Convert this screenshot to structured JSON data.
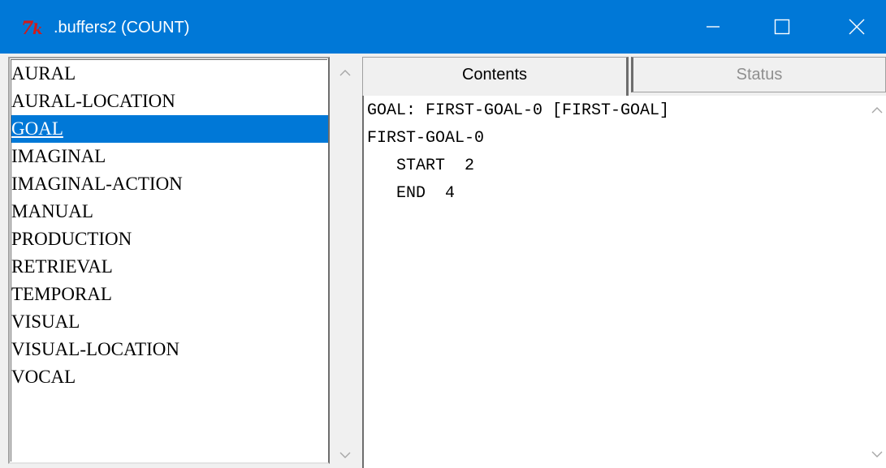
{
  "window": {
    "title": ".buffers2 (COUNT)",
    "logo": "Tk",
    "controls": {
      "minimize_icon": "minimize-icon",
      "maximize_icon": "maximize-icon",
      "close_icon": "close-icon"
    },
    "accent_color": "#0078d7"
  },
  "buffer_list": {
    "items": [
      {
        "label": "AURAL",
        "selected": false
      },
      {
        "label": "AURAL-LOCATION",
        "selected": false
      },
      {
        "label": "GOAL",
        "selected": true
      },
      {
        "label": "IMAGINAL",
        "selected": false
      },
      {
        "label": "IMAGINAL-ACTION",
        "selected": false
      },
      {
        "label": "MANUAL",
        "selected": false
      },
      {
        "label": "PRODUCTION",
        "selected": false
      },
      {
        "label": "RETRIEVAL",
        "selected": false
      },
      {
        "label": "TEMPORAL",
        "selected": false
      },
      {
        "label": "VISUAL",
        "selected": false
      },
      {
        "label": "VISUAL-LOCATION",
        "selected": false
      },
      {
        "label": "VOCAL",
        "selected": false
      }
    ]
  },
  "tabs": [
    {
      "label": "Contents",
      "active": true
    },
    {
      "label": "Status",
      "active": false
    }
  ],
  "contents": {
    "lines": [
      "GOAL: FIRST-GOAL-0 [FIRST-GOAL]",
      "FIRST-GOAL-0",
      "   START  2",
      "   END  4"
    ]
  }
}
